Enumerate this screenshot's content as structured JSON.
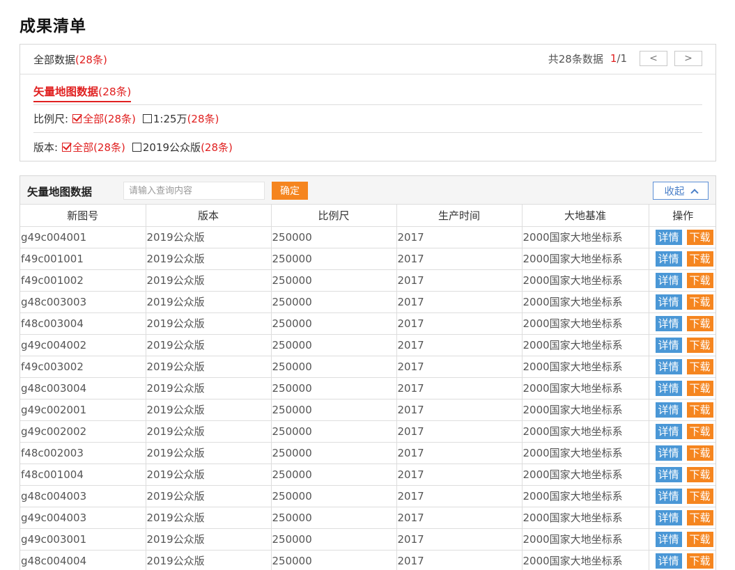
{
  "page": {
    "title": "成果清单"
  },
  "summary": {
    "all_label": "全部数据",
    "all_count": "(28条)"
  },
  "pager": {
    "total_text": "共28条数据",
    "current": "1",
    "total_pages": "/1",
    "prev": "<",
    "next": ">"
  },
  "tab": {
    "label": "矢量地图数据",
    "count": "(28条)"
  },
  "filters": {
    "scale": {
      "label": "比例尺:",
      "options": [
        {
          "label": "全部",
          "count": "(28条)",
          "checked": true
        },
        {
          "label": "1:25万",
          "count": "(28条)",
          "checked": false
        }
      ]
    },
    "version": {
      "label": "版本:",
      "options": [
        {
          "label": "全部",
          "count": "(28条)",
          "checked": true
        },
        {
          "label": "2019公众版",
          "count": "(28条)",
          "checked": false
        }
      ]
    }
  },
  "panel": {
    "title": "矢量地图数据",
    "search_placeholder": "请输入查询内容",
    "search_value": "",
    "ok_label": "确定",
    "collapse_label": "收起"
  },
  "table": {
    "columns": [
      "新图号",
      "版本",
      "比例尺",
      "生产时间",
      "大地基准",
      "操作"
    ],
    "detail_label": "详情",
    "download_label": "下载",
    "rows": [
      [
        "g49c004001",
        "2019公众版",
        "250000",
        "2017",
        "2000国家大地坐标系"
      ],
      [
        "f49c001001",
        "2019公众版",
        "250000",
        "2017",
        "2000国家大地坐标系"
      ],
      [
        "f49c001002",
        "2019公众版",
        "250000",
        "2017",
        "2000国家大地坐标系"
      ],
      [
        "g48c003003",
        "2019公众版",
        "250000",
        "2017",
        "2000国家大地坐标系"
      ],
      [
        "f48c003004",
        "2019公众版",
        "250000",
        "2017",
        "2000国家大地坐标系"
      ],
      [
        "g49c004002",
        "2019公众版",
        "250000",
        "2017",
        "2000国家大地坐标系"
      ],
      [
        "f49c003002",
        "2019公众版",
        "250000",
        "2017",
        "2000国家大地坐标系"
      ],
      [
        "g48c003004",
        "2019公众版",
        "250000",
        "2017",
        "2000国家大地坐标系"
      ],
      [
        "g49c002001",
        "2019公众版",
        "250000",
        "2017",
        "2000国家大地坐标系"
      ],
      [
        "g49c002002",
        "2019公众版",
        "250000",
        "2017",
        "2000国家大地坐标系"
      ],
      [
        "f48c002003",
        "2019公众版",
        "250000",
        "2017",
        "2000国家大地坐标系"
      ],
      [
        "f48c001004",
        "2019公众版",
        "250000",
        "2017",
        "2000国家大地坐标系"
      ],
      [
        "g48c004003",
        "2019公众版",
        "250000",
        "2017",
        "2000国家大地坐标系"
      ],
      [
        "g49c004003",
        "2019公众版",
        "250000",
        "2017",
        "2000国家大地坐标系"
      ],
      [
        "g49c003001",
        "2019公众版",
        "250000",
        "2017",
        "2000国家大地坐标系"
      ],
      [
        "g48c004004",
        "2019公众版",
        "250000",
        "2017",
        "2000国家大地坐标系"
      ]
    ]
  }
}
